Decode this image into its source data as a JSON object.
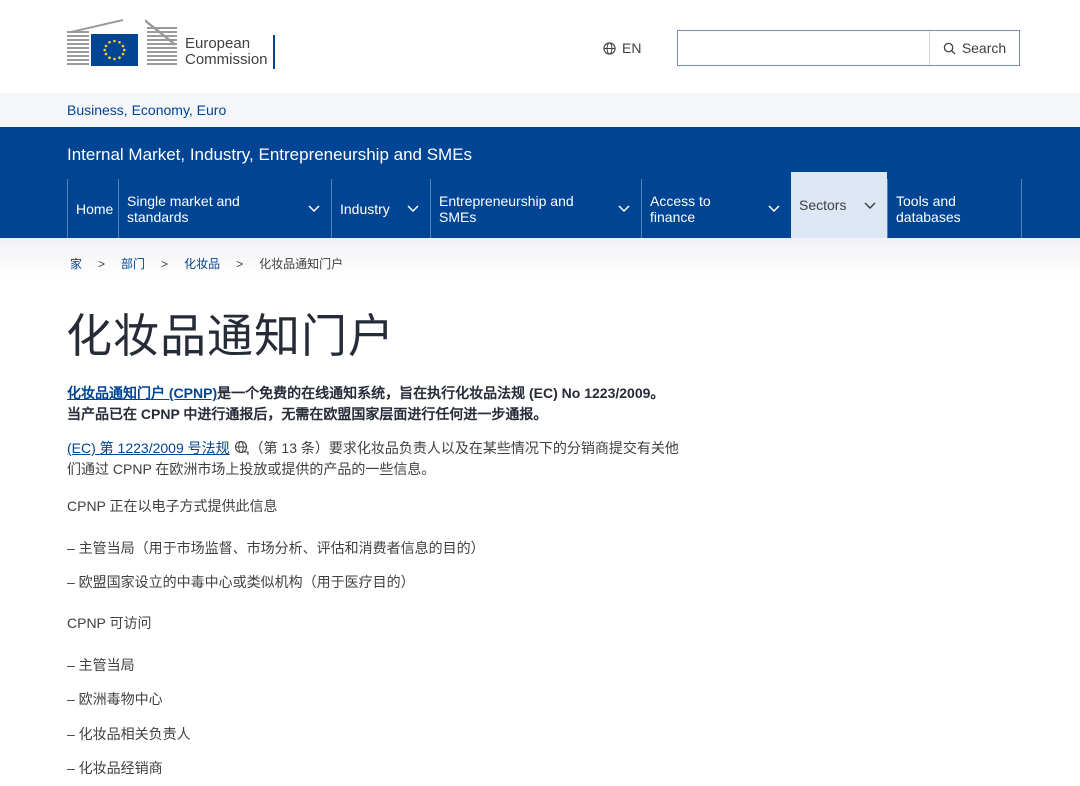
{
  "header": {
    "logo_line1": "European",
    "logo_line2": "Commission",
    "language": "EN",
    "search_label": "Search",
    "search_value": ""
  },
  "site_band": "Business, Economy, Euro",
  "site_title": "Internal Market, Industry, Entrepreneurship and SMEs",
  "menu": [
    {
      "label": "Home"
    },
    {
      "label": "Single market and standards"
    },
    {
      "label": "Industry"
    },
    {
      "label": "Entrepreneurship and SMEs"
    },
    {
      "label": "Access to finance"
    },
    {
      "label": "Sectors"
    },
    {
      "label": "Tools and databases"
    }
  ],
  "breadcrumb": [
    "家",
    "部门",
    "化妆品",
    "化妆品通知门户"
  ],
  "page_title": "化妆品通知门户",
  "lead": {
    "link": "化妆品通知门户 (CPNP)",
    "text": "是一个免费的在线通知系统，旨在执行化妆品法规 (EC) No 1223/2009。当产品已在 CPNP 中进行通报后，无需在欧盟国家层面进行任何进一步通报。"
  },
  "para2": {
    "link": "(EC) 第 1223/2009 号法规",
    "text": "（第 13 条）要求化妆品负责人以及在某些情况下的分销商提交有关他们通过 CPNP 在欧洲市场上投放或提供的产品的一些信息。"
  },
  "provides_heading": "CPNP 正在以电子方式提供此信息",
  "provides_items": [
    "– 主管当局（用于市场监督、市场分析、评估和消费者信息的目的）",
    "– 欧盟国家设立的中毒中心或类似机构（用于医疗目的）"
  ],
  "access_heading": "CPNP 可访问",
  "access_items": [
    "–  主管当局",
    "–  欧洲毒物中心",
    "– 化妆品相关负责人",
    "– 化妆品经销商"
  ],
  "colors": {
    "brand_blue": "#004494",
    "active_tab": "#dde6f5"
  }
}
